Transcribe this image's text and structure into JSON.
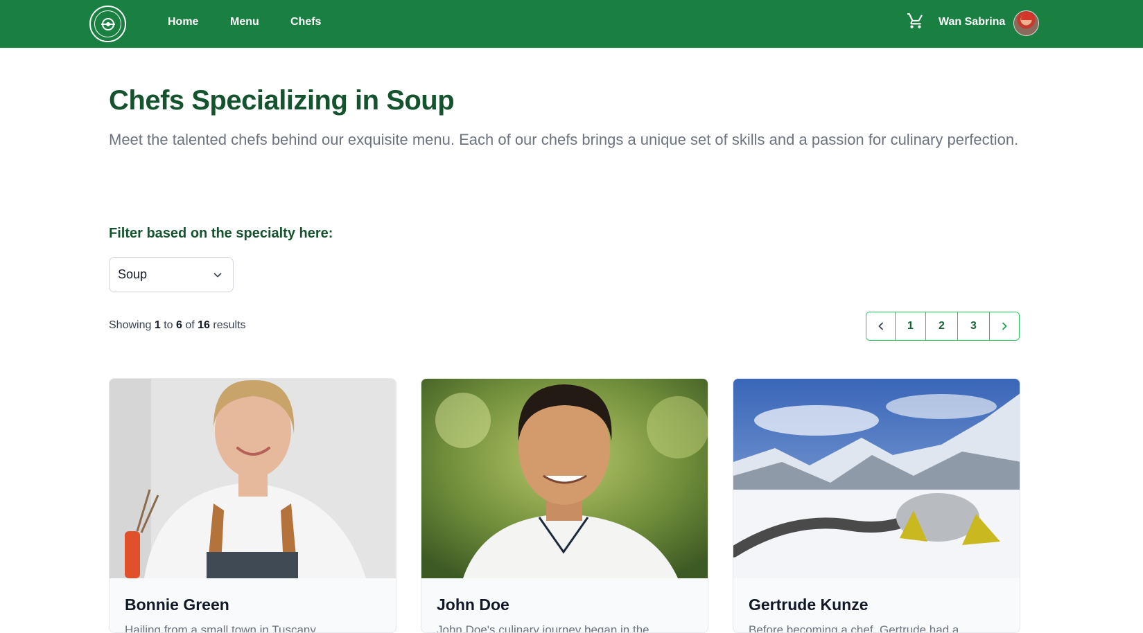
{
  "nav": {
    "links": [
      "Home",
      "Menu",
      "Chefs"
    ],
    "user_name": "Wan Sabrina"
  },
  "header": {
    "title": "Chefs Specializing in Soup",
    "description": "Meet the talented chefs behind our exquisite menu. Each of our chefs brings a unique set of skills and a passion for culinary perfection."
  },
  "filter": {
    "label": "Filter based on the specialty here:",
    "selected": "Soup"
  },
  "results": {
    "prefix": "Showing",
    "from": "1",
    "to_word": "to",
    "to": "6",
    "of_word": "of",
    "total": "16",
    "suffix": "results"
  },
  "pagination": {
    "prev_icon": "chevron-left-icon",
    "pages": [
      "1",
      "2",
      "3"
    ],
    "next_icon": "chevron-right-icon"
  },
  "chefs": [
    {
      "name": "Bonnie Green",
      "excerpt": "Hailing from a small town in Tuscany"
    },
    {
      "name": "John Doe",
      "excerpt": "John Doe's culinary journey began in the"
    },
    {
      "name": "Gertrude Kunze",
      "excerpt": "Before becoming a chef, Gertrude had a"
    }
  ],
  "colors": {
    "nav_bg": "#1a8042",
    "title": "#14532d",
    "pager_border": "#22c55e"
  }
}
